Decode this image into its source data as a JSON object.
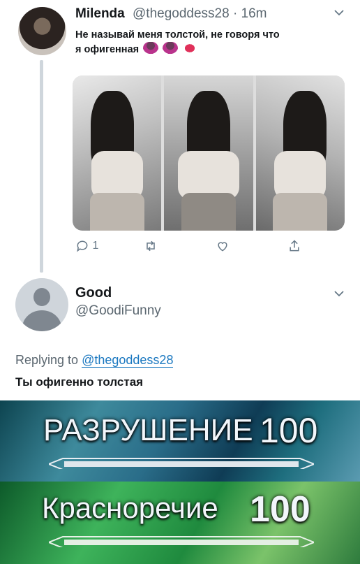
{
  "tweet1": {
    "name": "Milenda",
    "handle_time": "@thegoddess28 · 16m",
    "text": "Не называй меня толстой, не говоря что я офигенная",
    "reply_count": "1"
  },
  "tweet2": {
    "name": "Good",
    "handle": "@GoodiFunny",
    "replying_prefix": "Replying to",
    "replying_handle": "@thegoddess28",
    "text": "Ты офигенно толстая"
  },
  "skill1": {
    "name": "РАЗРУШЕНИЕ",
    "level": "100"
  },
  "skill2": {
    "name": "Красноречие",
    "level": "100"
  },
  "icons": [
    "chevron-down-icon",
    "reply-icon",
    "retweet-icon",
    "like-icon",
    "share-icon"
  ]
}
